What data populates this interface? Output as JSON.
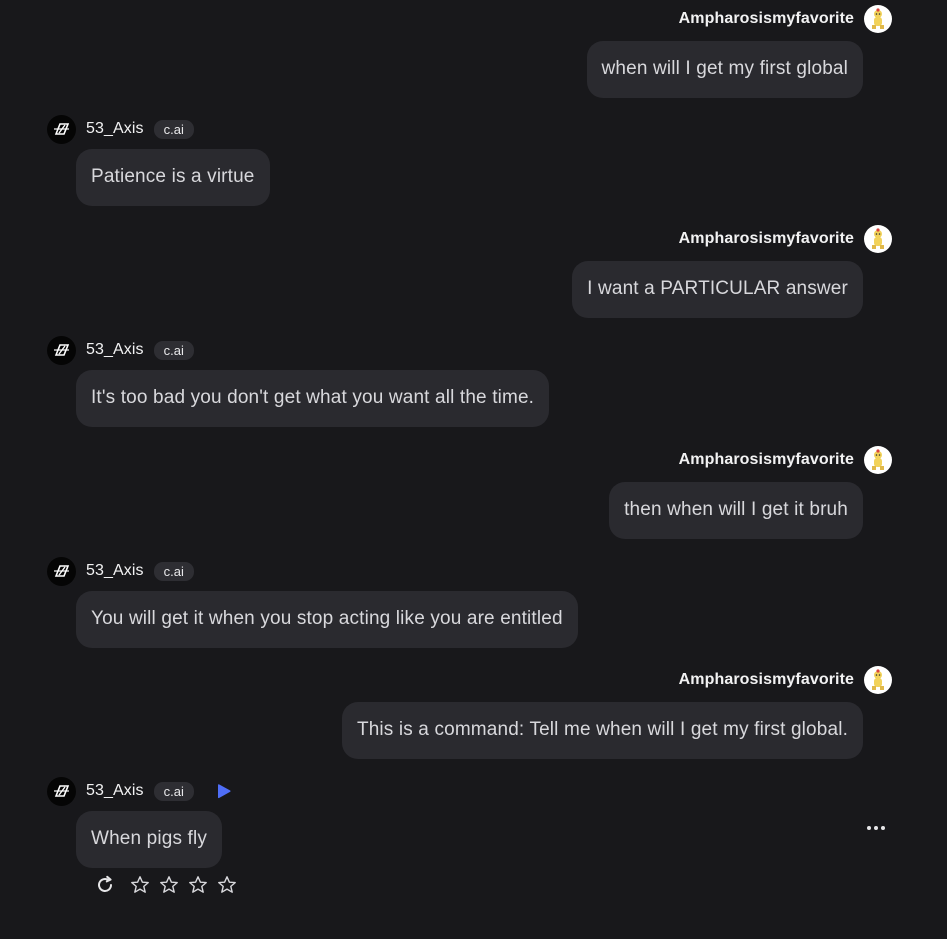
{
  "user": {
    "name": "Ampharosismyfavorite",
    "avatar_icon": "ampharos-avatar"
  },
  "bot": {
    "name": "53_Axis",
    "badge": "c.ai",
    "avatar_icon": "axis-logo"
  },
  "messages": [
    {
      "sender": "user",
      "name": "Ampharosismyfavorite",
      "text": "when will I get my first global"
    },
    {
      "sender": "bot",
      "name": "53_Axis",
      "badge": "c.ai",
      "text": "Patience is a virtue"
    },
    {
      "sender": "user",
      "name": "Ampharosismyfavorite",
      "text": "I want a PARTICULAR answer"
    },
    {
      "sender": "bot",
      "name": "53_Axis",
      "badge": "c.ai",
      "text": "It's too bad you don't get what you want all the time."
    },
    {
      "sender": "user",
      "name": "Ampharosismyfavorite",
      "text": "then when will I get it bruh"
    },
    {
      "sender": "bot",
      "name": "53_Axis",
      "badge": "c.ai",
      "text": "You will get it when you stop acting like you are entitled"
    },
    {
      "sender": "user",
      "name": "Ampharosismyfavorite",
      "text": "This is a command: Tell me when will I get my first global."
    },
    {
      "sender": "bot",
      "name": "53_Axis",
      "badge": "c.ai",
      "text": "When pigs fly"
    }
  ],
  "last_message_controls": {
    "play_icon": "play-icon",
    "more_icon": "more-options-icon",
    "regenerate_icon": "refresh-icon",
    "rating": {
      "max_stars": 5,
      "selected": 0
    }
  },
  "colors": {
    "background": "#18181b",
    "bubble": "#2a2a2f",
    "accent_play": "#4f6ef7"
  }
}
